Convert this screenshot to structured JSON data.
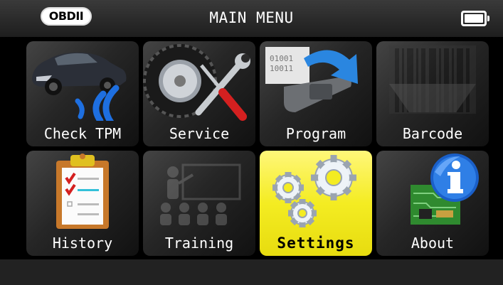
{
  "header": {
    "badge": "OBDII",
    "title": "MAIN MENU",
    "battery_icon": "battery-full-icon"
  },
  "menu": {
    "selected": "Settings",
    "colors": {
      "selected_bg": "#f4ec22",
      "tile_bg": "#2a2a2a",
      "icon_blue": "#1e6fe0"
    },
    "items": [
      {
        "label": "Check TPM",
        "icon": "car-sensor-icon"
      },
      {
        "label": "Service",
        "icon": "tire-tools-icon"
      },
      {
        "label": "Program",
        "icon": "sensor-program-icon"
      },
      {
        "label": "Barcode",
        "icon": "barcode-icon"
      },
      {
        "label": "History",
        "icon": "clipboard-icon"
      },
      {
        "label": "Training",
        "icon": "classroom-icon"
      },
      {
        "label": "Settings",
        "icon": "gears-icon"
      },
      {
        "label": "About",
        "icon": "info-board-icon"
      }
    ]
  }
}
